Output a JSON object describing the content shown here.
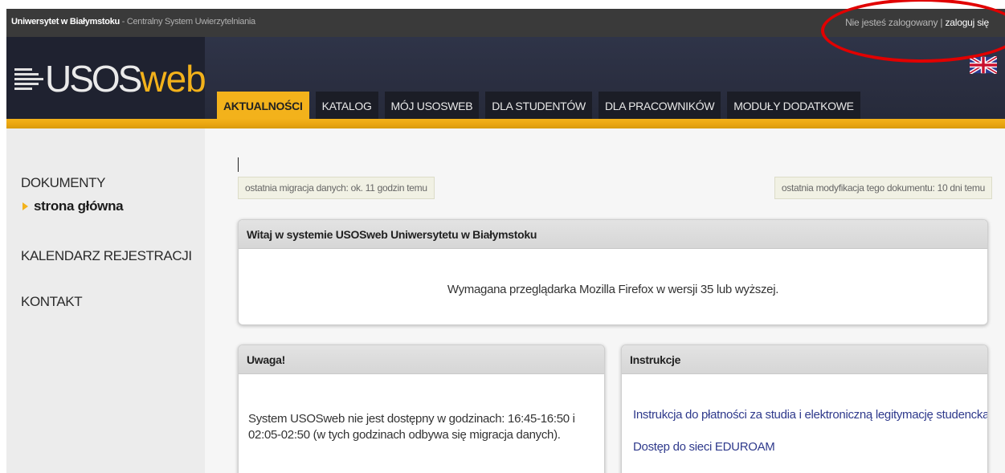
{
  "topbar": {
    "university": "Uniwersytet w Białymstoku",
    "subtitle": "- Centralny System Uwierzytelniania",
    "status": "Nie jesteś zalogowany",
    "separator": " | ",
    "login": "zaloguj się"
  },
  "logo": {
    "part1": "USOS",
    "part2": "web"
  },
  "tabs": [
    {
      "label": "AKTUALNOŚCI"
    },
    {
      "label": "KATALOG"
    },
    {
      "label": "MÓJ USOSWEB"
    },
    {
      "label": "DLA STUDENTÓW"
    },
    {
      "label": "DLA PRACOWNIKÓW"
    },
    {
      "label": "MODUŁY DODATKOWE"
    }
  ],
  "sidebar": {
    "documents": "DOKUMENTY",
    "home": "strona główna",
    "calendar": "KALENDARZ REJESTRACJI",
    "contact": "KONTAKT"
  },
  "notes": {
    "migration": "ostatnia migracja danych: ok. 11 godzin temu",
    "modified": "ostatnia modyfikacja tego dokumentu: 10 dni temu"
  },
  "welcome": {
    "title": "Witaj w systemie USOSweb Uniwersytetu w Białymstoku",
    "text": "Wymagana przeglądarka Mozilla Firefox w wersji 35 lub wyższej."
  },
  "warning": {
    "title": "Uwaga!",
    "line1": "System USOSweb nie jest dostępny w godzinach: 16:45-16:50 i",
    "line2": "02:05-02:50 (w tych godzinach odbywa się migracja danych)."
  },
  "instructions": {
    "title": "Instrukcje",
    "link1": "Instrukcja do płatności za studia i elektroniczną legitymację studencką",
    "link2": "Dostęp do sieci EDUROAM"
  },
  "colors": {
    "accent": "#f3b21b",
    "header": "#2a2e40",
    "link": "#2f3a8c",
    "annotation": "#e10000"
  }
}
